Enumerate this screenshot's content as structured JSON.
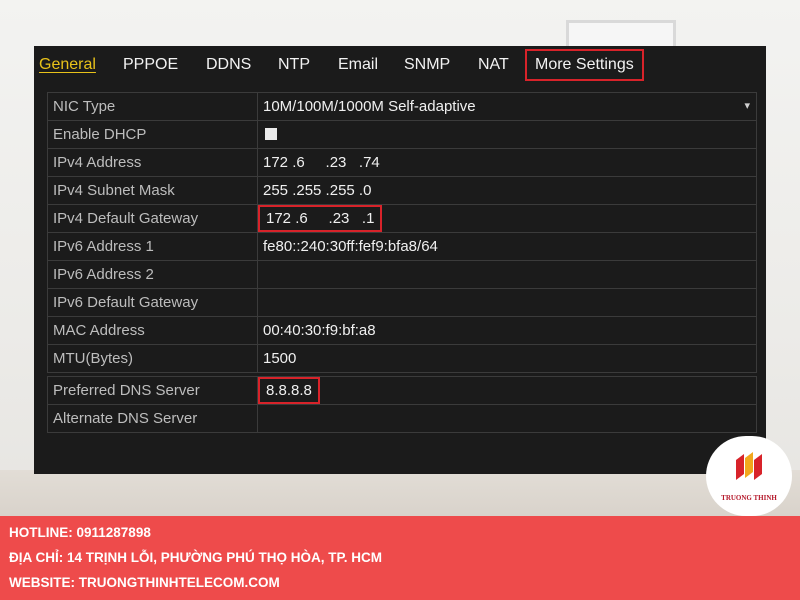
{
  "tabs": {
    "items": [
      {
        "label": "General"
      },
      {
        "label": "PPPOE"
      },
      {
        "label": "DDNS"
      },
      {
        "label": "NTP"
      },
      {
        "label": "Email"
      },
      {
        "label": "SNMP"
      },
      {
        "label": "NAT"
      },
      {
        "label": "More Settings"
      }
    ]
  },
  "network": {
    "rows": [
      {
        "label": "NIC Type",
        "value": "10M/100M/1000M Self-adaptive"
      },
      {
        "label": "Enable DHCP",
        "value": ""
      },
      {
        "label": "IPv4 Address",
        "value": "172 .6     .23   .74"
      },
      {
        "label": "IPv4 Subnet Mask",
        "value": "255 .255 .255 .0"
      },
      {
        "label": "IPv4 Default Gateway",
        "value": "172 .6     .23   .1"
      },
      {
        "label": "IPv6 Address 1",
        "value": "fe80::240:30ff:fef9:bfa8/64"
      },
      {
        "label": "IPv6 Address 2",
        "value": ""
      },
      {
        "label": "IPv6 Default Gateway",
        "value": ""
      },
      {
        "label": "MAC Address",
        "value": "00:40:30:f9:bf:a8"
      },
      {
        "label": "MTU(Bytes)",
        "value": "1500"
      }
    ]
  },
  "dns": {
    "rows": [
      {
        "label": "Preferred DNS Server",
        "value": "8.8.8.8"
      },
      {
        "label": "Alternate DNS Server",
        "value": ""
      }
    ]
  },
  "brand": {
    "name": "TRUONG THINH"
  },
  "footer": {
    "hotline": "HOTLINE: 0911287898",
    "address": "ĐỊA CHỈ: 14 TRỊNH LỖI, PHƯỜNG PHÚ THỌ HÒA, TP. HCM",
    "website": "WEBSITE: TRUONGTHINHTELECOM.COM"
  },
  "colors": {
    "highlight": "#d8232a",
    "active_tab": "#e8c21a",
    "footer_bg": "#ee4b4b"
  }
}
